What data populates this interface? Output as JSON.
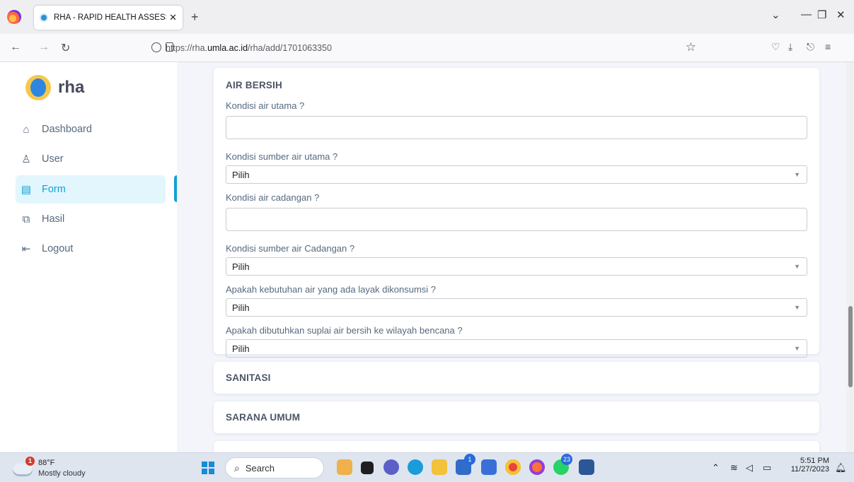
{
  "browser": {
    "tab_title": "RHA - RAPID HEALTH ASSESSM",
    "tab_close": "✕",
    "new_tab": "+",
    "url_prefix": "https://rha.",
    "url_domain": "umla.ac.id",
    "url_path": "/rha/add/1701063350"
  },
  "sidebar": {
    "brand": "rha",
    "items": [
      {
        "label": "Dashboard",
        "icon": "home-icon",
        "glyph": "⌂"
      },
      {
        "label": "User",
        "icon": "user-icon",
        "glyph": "♙"
      },
      {
        "label": "Form",
        "icon": "form-icon",
        "glyph": "▤"
      },
      {
        "label": "Hasil",
        "icon": "copy-icon",
        "glyph": "⧉"
      },
      {
        "label": "Logout",
        "icon": "logout-icon",
        "glyph": "⇤"
      }
    ],
    "active": "Form"
  },
  "form": {
    "section_title": "AIR BERSIH",
    "fields": [
      {
        "label": "Kondisi air utama ?",
        "type": "text",
        "value": ""
      },
      {
        "label": "Kondisi sumber air utama ?",
        "type": "select",
        "value": "Pilih"
      },
      {
        "label": "Kondisi air cadangan ?",
        "type": "text",
        "value": ""
      },
      {
        "label": "Kondisi sumber air Cadangan ?",
        "type": "select",
        "value": "Pilih"
      },
      {
        "label": "Apakah kebutuhan air yang ada layak dikonsumsi ?",
        "type": "select",
        "value": "Pilih"
      },
      {
        "label": "Apakah dibutuhkan suplai air bersih ke wilayah bencana ?",
        "type": "select",
        "value": "Pilih"
      }
    ],
    "collapsed_sections": [
      "SANITASI",
      "SARANA UMUM"
    ]
  },
  "taskbar": {
    "weather_badge": "1",
    "temperature": "88°F",
    "weather": "Mostly cloudy",
    "search": "Search",
    "badge_store": "1",
    "badge_whatsapp": "23",
    "time": "5:51 PM",
    "date": "11/27/2023"
  },
  "colors": {
    "accent": "#0fa2d6",
    "active_bg": "#e3f6fd"
  }
}
